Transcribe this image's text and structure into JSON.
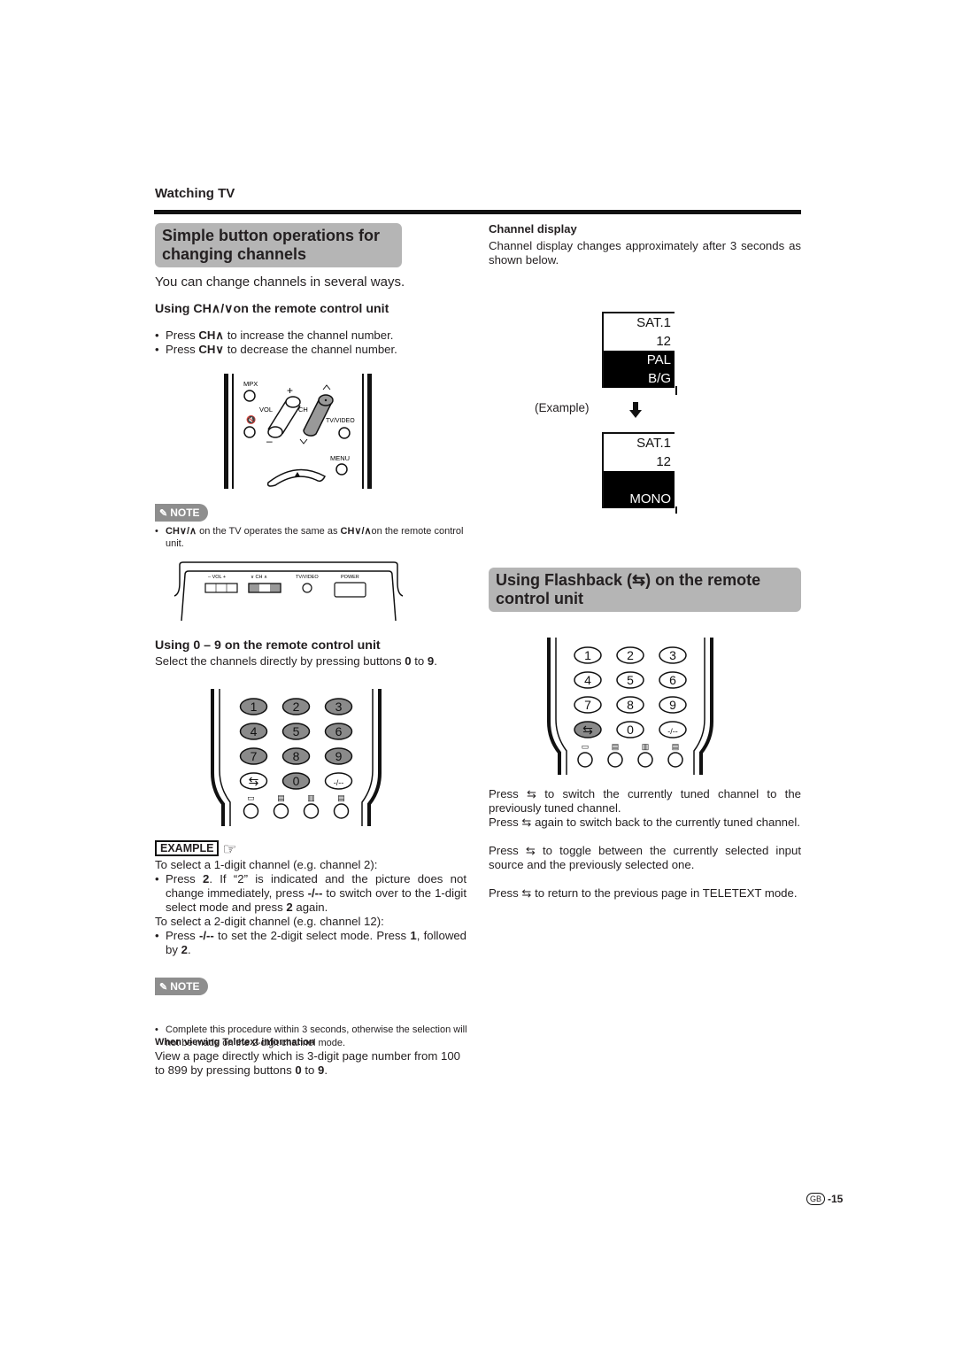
{
  "header": {
    "section": "Watching TV"
  },
  "left": {
    "title": "Simple button operations for changing channels",
    "title_line1": "Simple button operations for",
    "title_line2": "changing channels",
    "intro": "You can change channels in several ways.",
    "ch_heading": "Using CH∧/∨on the remote control unit",
    "ch_bullets": [
      {
        "prefix": "Press ",
        "key": "CH∧",
        "rest": " to increase the channel number."
      },
      {
        "prefix": "Press ",
        "key": "CH∨",
        "rest": " to decrease the channel number."
      }
    ],
    "remote_top": {
      "labels": {
        "mpx": "MPX",
        "vol": "VOL",
        "ch": "CH",
        "tv_video": "TV/VIDEO",
        "menu": "MENU",
        "plus": "+",
        "minus": "–"
      }
    },
    "note1": {
      "badge": "NOTE",
      "key1": "CH∨/∧",
      "text1": " on the TV operates the same as ",
      "key2": "CH∨/∧",
      "text2": "on the remote control unit."
    },
    "tv_panel": {
      "vol": "–  VOL  +",
      "ch": "∨  CH  ∧",
      "tv_video": "TV/VIDEO",
      "power": "POWER"
    },
    "digits_heading": "Using 0 – 9 on the remote control unit",
    "digits_text_a": "Select the channels directly by pressing buttons ",
    "digits_key0": "0",
    "digits_text_b": " to ",
    "digits_key9": "9",
    "digits_text_c": ".",
    "keypad": [
      "1",
      "2",
      "3",
      "4",
      "5",
      "6",
      "7",
      "8",
      "9",
      "⇆",
      "0",
      "-/--"
    ],
    "example": {
      "badge": "EXAMPLE",
      "line1": "To select a 1-digit channel (e.g. channel 2):",
      "b1_a": "Press ",
      "b1_k1": "2",
      "b1_b": ". If “2” is indicated and the picture does not change immediately, press ",
      "b1_k2": "-/--",
      "b1_c": " to switch over to the 1-digit select mode and press ",
      "b1_k3": "2",
      "b1_d": " again.",
      "line2": "To select a 2-digit channel (e.g. channel 12):",
      "b2_a": "Press ",
      "b2_k1": "-/--",
      "b2_b": " to set the 2-digit select mode. Press ",
      "b2_k2": "1",
      "b2_c": ", followed by ",
      "b2_k3": "2",
      "b2_d": "."
    },
    "note2": {
      "badge": "NOTE",
      "text": "Complete this procedure within 3 seconds, otherwise the selection will not be made on the 2-digit channel mode."
    },
    "teletext": {
      "heading": "When viewing Teletext information",
      "text_a": "View a page directly which is 3-digit page number from 100 to 899 by pressing buttons ",
      "k0": "0",
      "text_b": " to ",
      "k9": "9",
      "text_c": "."
    }
  },
  "right": {
    "channel_display": {
      "heading": "Channel display",
      "text": "Channel display changes approximately after 3 seconds as shown below.",
      "example_label": "(Example)",
      "osd_before": [
        "SAT.1",
        "12",
        "PAL",
        "B/G"
      ],
      "osd_after": [
        "SAT.1",
        "12",
        "",
        "MONO"
      ]
    },
    "flashback": {
      "title_line1": "Using Flashback (⇆) on the remote",
      "title_line2": "control unit",
      "keypad": [
        "1",
        "2",
        "3",
        "4",
        "5",
        "6",
        "7",
        "8",
        "9",
        "⇆",
        "0",
        "-/--"
      ],
      "p1_a": "Press ",
      "p1_b": " to switch the currently tuned channel to the previously tuned channel.",
      "p2_a": "Press ",
      "p2_b": " again to switch back to the currently tuned channel.",
      "p3_a": "Press ",
      "p3_b": " to toggle between the currently selected input source and the previously selected one.",
      "p4_a": "Press ",
      "p4_b": " to return to the previous page in TELETEXT mode."
    }
  },
  "footer": {
    "region": "GB",
    "page": "-15"
  }
}
